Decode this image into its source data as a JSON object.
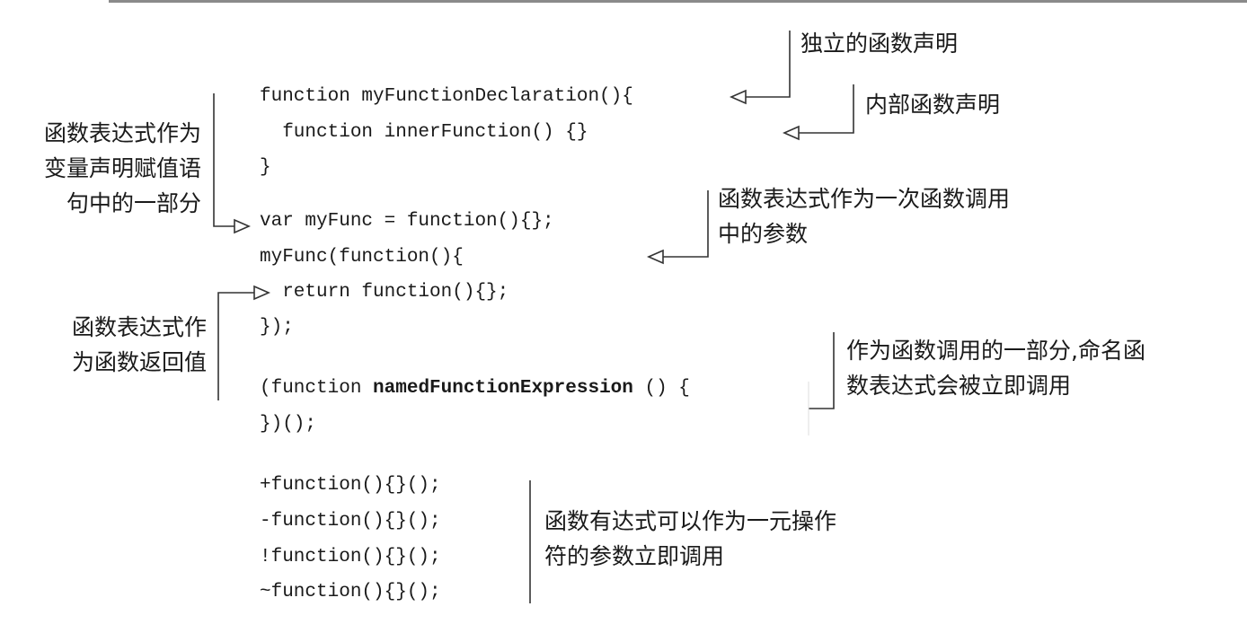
{
  "code": {
    "decl_line": "function myFunctionDeclaration(){",
    "inner_line": "  function innerFunction() {}",
    "decl_close": "}",
    "var_line": "var myFunc = function(){};",
    "call_line": "myFunc(function(){",
    "return_line": "  return function(){};",
    "call_close": "});",
    "iife_open": "(function ",
    "iife_name": "namedFunctionExpression",
    "iife_rest": " () {",
    "iife_close": "})();",
    "unary_plus": "+function(){}();",
    "unary_minus": "-function(){}();",
    "unary_not": "!function(){}();",
    "unary_tilde": "~function(){}();"
  },
  "annotations": {
    "standalone_decl": "独立的函数声明",
    "inner_decl": "内部函数声明",
    "var_assign": "函数表达式作为\n变量声明赋值语\n句中的一部分",
    "call_argument": "函数表达式作为一次函数调用\n中的参数",
    "return_value": "函数表达式作\n为函数返回值",
    "named_iife": "作为函数调用的一部分,命名函\n数表达式会被立即调用",
    "unary_operator": "函数有达式可以作为一元操作\n符的参数立即调用"
  }
}
